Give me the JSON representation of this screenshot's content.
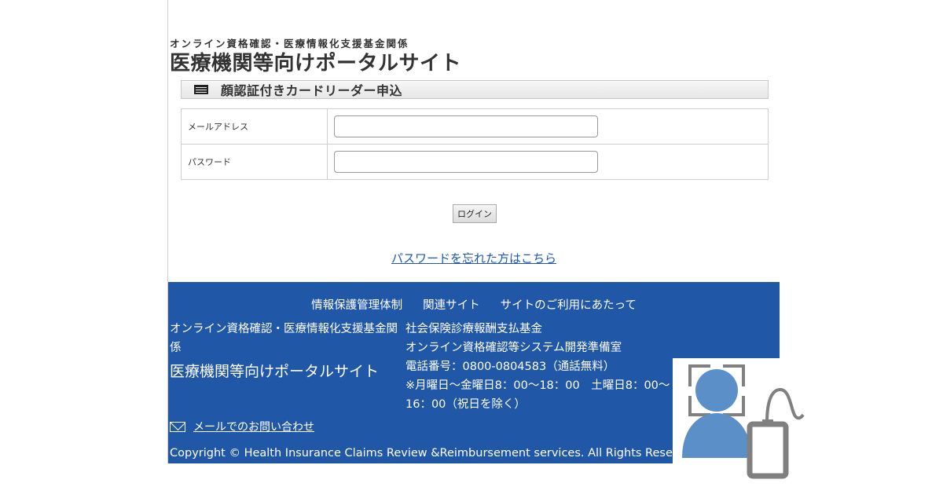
{
  "header": {
    "org_subtitle": "オンライン資格確認・医療情報化支援基金関係",
    "portal_title": "医療機関等向けポータルサイト"
  },
  "section": {
    "title": "顔認証付きカードリーダー申込",
    "icon": "list-icon"
  },
  "form": {
    "email_label": "メールアドレス",
    "email_value": "",
    "password_label": "パスワード",
    "password_value": "",
    "login_label": "ログイン",
    "forgot_password_link": "パスワードを忘れた方はこちら"
  },
  "footer": {
    "nav": [
      "情報保護管理体制",
      "関連サイト",
      "サイトのご利用にあたって"
    ],
    "left_org": "オンライン資格確認・医療情報化支援基金関係",
    "left_portal": "医療機関等向けポータルサイト",
    "right_org": "社会保険診療報酬支払基金",
    "right_office": "オンライン資格確認等システム開発準備室",
    "phone": "電話番号：0800-0804583（通話無料）",
    "hours": "※月曜日〜金曜日8：00〜18：00　土曜日8：00〜16：00（祝日を除く）",
    "mail_link": "メールでのお問い合わせ",
    "copyright": "Copyright © Health Insurance Claims Review &Reimbursement services. All Rights Reserved.",
    "background_color": "#2157a7"
  },
  "illustration": {
    "icon": "face-recognition-card-reader-icon",
    "person_color": "#5b8fc7",
    "device_color": "#808080"
  }
}
